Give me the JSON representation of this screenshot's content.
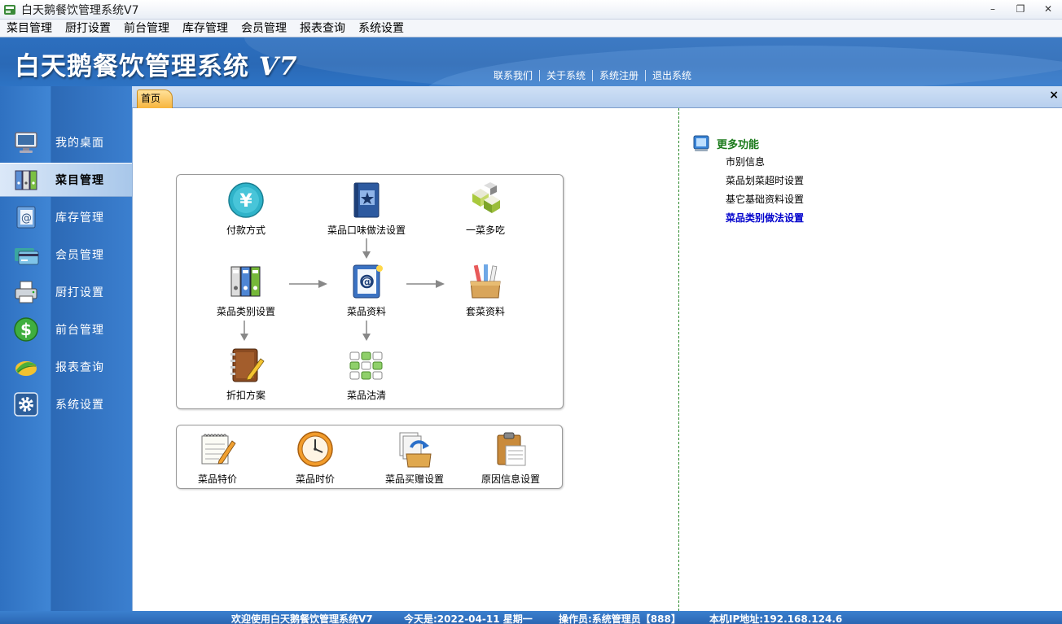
{
  "window": {
    "title": "白天鹅餐饮管理系统V7",
    "minimize": "–",
    "restore": "❐",
    "close": "✕"
  },
  "menubar": [
    "菜目管理",
    "厨打设置",
    "前台管理",
    "库存管理",
    "会员管理",
    "报表查询",
    "系统设置"
  ],
  "banner": {
    "title": "白天鹅餐饮管理系统",
    "version": "V7",
    "links": [
      "联系我们",
      "关于系统",
      "系统注册",
      "退出系统"
    ]
  },
  "sidebar": {
    "items": [
      {
        "label": "我的桌面",
        "icon": "monitor-icon"
      },
      {
        "label": "菜目管理",
        "icon": "binders-icon"
      },
      {
        "label": "库存管理",
        "icon": "address-book-icon"
      },
      {
        "label": "会员管理",
        "icon": "credit-card-icon"
      },
      {
        "label": "厨打设置",
        "icon": "printer-icon"
      },
      {
        "label": "前台管理",
        "icon": "dollar-icon"
      },
      {
        "label": "报表查询",
        "icon": "leaf-icon"
      },
      {
        "label": "系统设置",
        "icon": "gear-icon"
      }
    ],
    "active_index": 1
  },
  "tabs": {
    "home": "首页",
    "close": "×"
  },
  "workflow": {
    "payment": "付款方式",
    "taste": "菜品口味做法设置",
    "one_dish": "一菜多吃",
    "category": "菜品类别设置",
    "dish_info": "菜品资料",
    "combo": "套菜资料",
    "discount": "折扣方案",
    "sold_out": "菜品沽清"
  },
  "tools": {
    "special_price": "菜品特价",
    "time_price": "菜品时价",
    "buy_gift": "菜品买赠设置",
    "reason": "原因信息设置"
  },
  "more": {
    "title": "更多功能",
    "links": [
      "市别信息",
      "菜品划菜超时设置",
      "基它基础资料设置",
      "菜品类别做法设置"
    ],
    "highlight_index": 3
  },
  "status": {
    "welcome": "欢迎使用白天鹅餐饮管理系统V7",
    "today": "今天是:2022-04-11 星期一",
    "operator": "操作员:系统管理员【888】",
    "ip": "本机IP地址:192.168.124.6"
  },
  "colors": {
    "banner": "#2a69b6",
    "sidebar": "#3b7fcf",
    "tab_active": "#f7b53e",
    "more_title": "#1a7a1a",
    "link_highlight": "#0000cc"
  }
}
